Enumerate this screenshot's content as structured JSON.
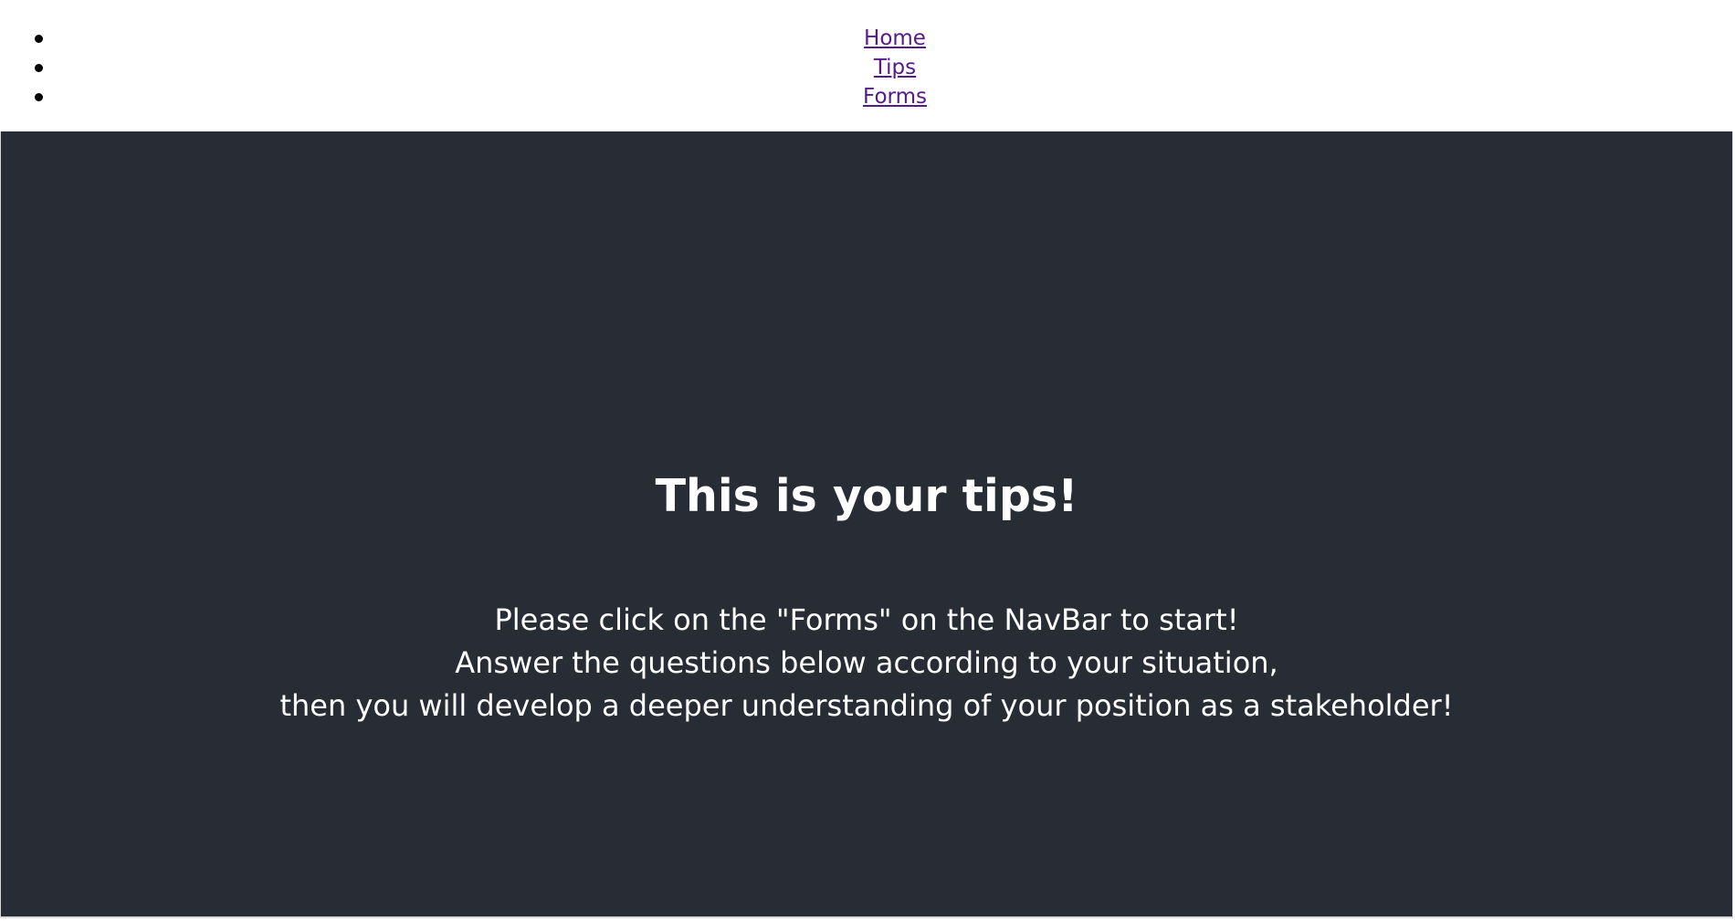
{
  "nav": {
    "items": [
      {
        "label": "Home"
      },
      {
        "label": "Tips"
      },
      {
        "label": "Forms"
      }
    ]
  },
  "hero": {
    "title": "This is your tips!",
    "lines": [
      "Please click on the \"Forms\" on the NavBar to start!",
      "Answer the questions below according to your situation,",
      "then you will develop a deeper understanding of your position as a stakeholder!"
    ]
  },
  "colors": {
    "hero_background": "#282c34",
    "link_visited": "#551a8b",
    "hero_text": "#ffffff"
  }
}
